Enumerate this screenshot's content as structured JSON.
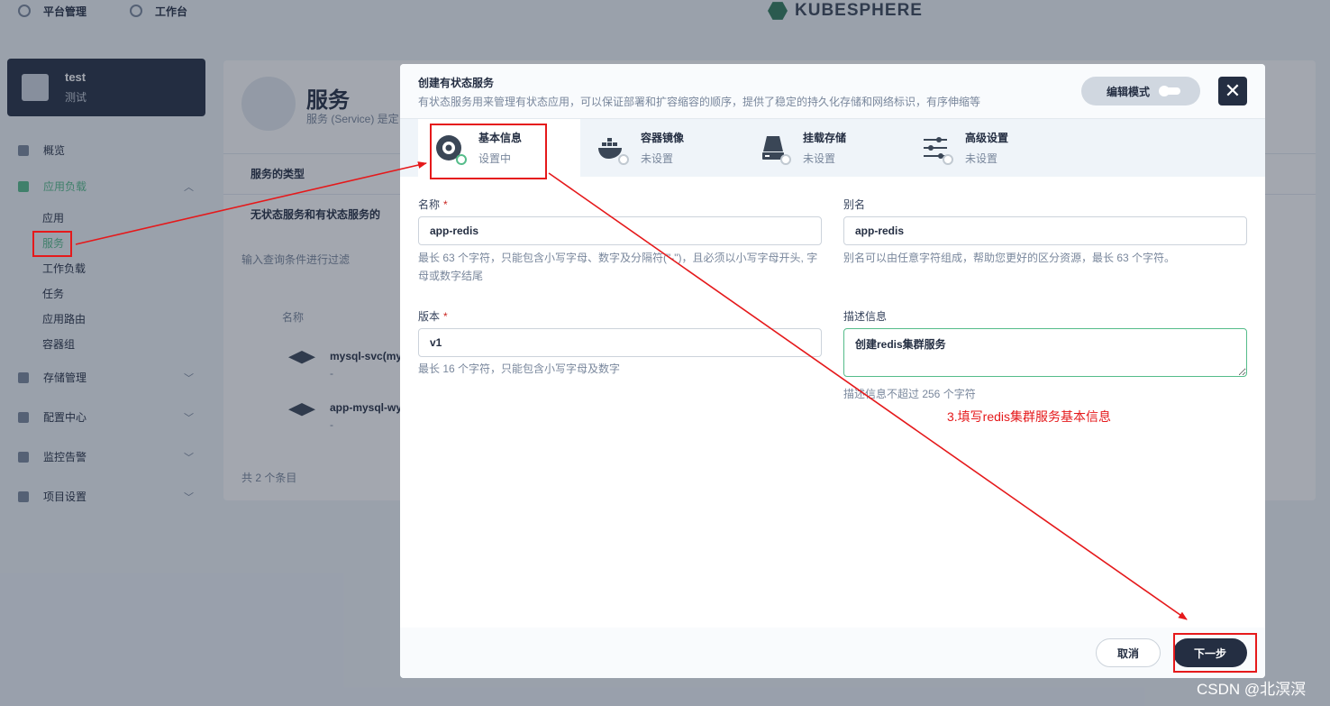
{
  "topbar": {
    "nav": [
      {
        "label": "平台管理",
        "icon": "gear-icon"
      },
      {
        "label": "工作台",
        "icon": "workbench-icon"
      }
    ],
    "logo_text": "KUBESPHERE"
  },
  "project": {
    "name": "test",
    "alias": "测试"
  },
  "sidebar": {
    "overview": "概览",
    "app_workloads": "应用负载",
    "sub_items": [
      "应用",
      "服务",
      "工作负载",
      "任务",
      "应用路由",
      "容器组"
    ],
    "storage": "存储管理",
    "config": "配置中心",
    "monitoring": "监控告警",
    "project_settings": "项目设置"
  },
  "page": {
    "title": "服务",
    "desc": "服务 (Service) 是定",
    "collapse_1": "服务的类型",
    "collapse_2": "无状态服务和有状态服务的",
    "search_placeholder": "输入查询条件进行过滤",
    "col_name": "名称",
    "rows": [
      {
        "name": "mysql-svc(mys",
        "sub": "-"
      },
      {
        "name": "app-mysql-wy",
        "sub": "-"
      }
    ],
    "total": "共 2 个条目"
  },
  "modal": {
    "title": "创建有状态服务",
    "desc": "有状态服务用来管理有状态应用，可以保证部署和扩容缩容的顺序，提供了稳定的持久化存储和网络标识，有序伸缩等",
    "edit_mode": "编辑模式",
    "close": "✕",
    "tabs": [
      {
        "label": "基本信息",
        "status": "设置中"
      },
      {
        "label": "容器镜像",
        "status": "未设置"
      },
      {
        "label": "挂载存储",
        "status": "未设置"
      },
      {
        "label": "高级设置",
        "status": "未设置"
      }
    ],
    "form": {
      "name_label": "名称",
      "name_value": "app-redis",
      "name_help": "最长 63 个字符，只能包含小写字母、数字及分隔符(\"-\")，且必须以小写字母开头, 字母或数字结尾",
      "alias_label": "别名",
      "alias_value": "app-redis",
      "alias_help": "别名可以由任意字符组成，帮助您更好的区分资源，最长 63 个字符。",
      "version_label": "版本",
      "version_value": "v1",
      "version_help": "最长 16 个字符，只能包含小写字母及数字",
      "desc_label": "描述信息",
      "desc_value": "创建redis集群服务",
      "desc_help": "描述信息不超过 256 个字符",
      "required_mark": "*"
    },
    "footer": {
      "cancel": "取消",
      "next": "下一步"
    }
  },
  "annotation": {
    "note": "3.填写redis集群服务基本信息",
    "color": "#e5191b"
  },
  "watermark": "CSDN @北溟溟",
  "colors": {
    "accent": "#55bc8a",
    "dark": "#242e42",
    "muted": "#79879c"
  }
}
